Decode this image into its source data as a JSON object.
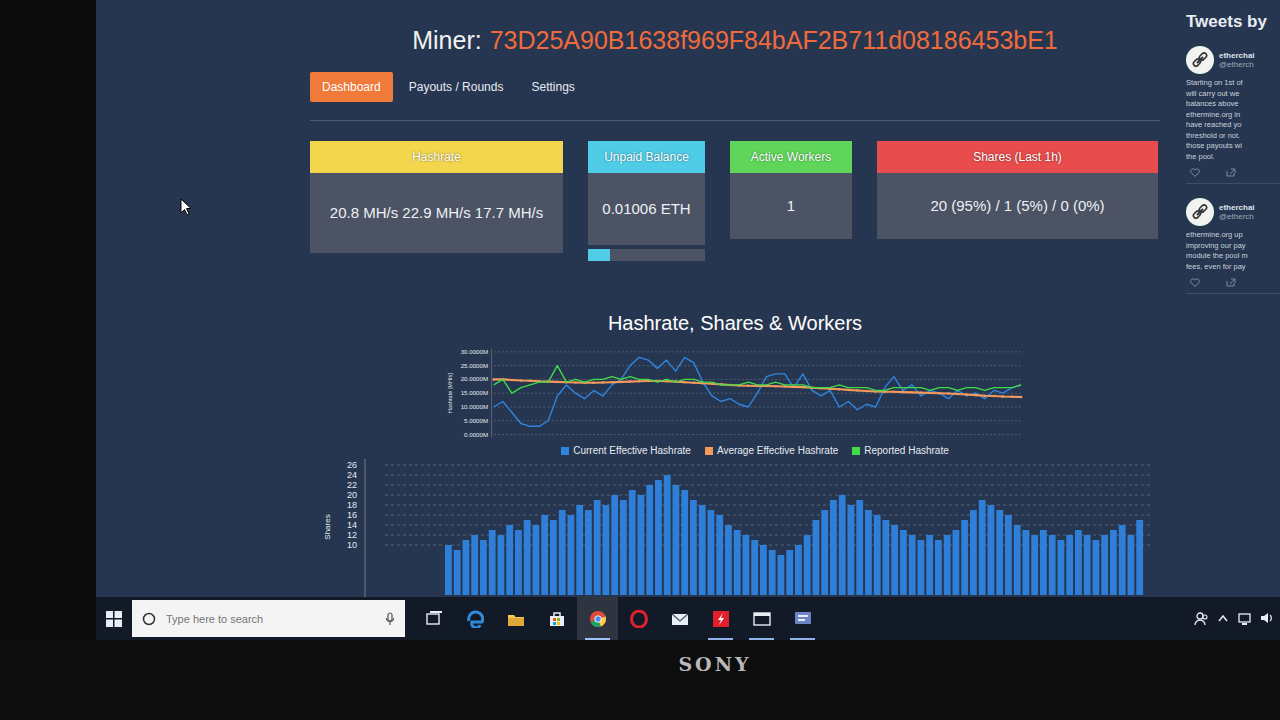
{
  "miner": {
    "label": "Miner:",
    "address": "73D25A90B1638f969F84bAF2B711d08186453bE1"
  },
  "tabs": [
    {
      "label": "Dashboard",
      "selected": true
    },
    {
      "label": "Payouts / Rounds",
      "selected": false
    },
    {
      "label": "Settings",
      "selected": false
    }
  ],
  "cards": [
    {
      "kind": "text",
      "title": "Hashrate",
      "color": "#f3d64c",
      "value": "20.8 MH/s  22.9 MH/s  17.7 MH/s"
    },
    {
      "kind": "progress",
      "title": "Unpaid Balance",
      "color": "#4fcde6",
      "value": "0.01006 ETH",
      "level": 0.19
    },
    {
      "kind": "text",
      "title": "Active Workers",
      "color": "#5fd65a",
      "value": "1"
    },
    {
      "kind": "text",
      "title": "Shares (Last 1h)",
      "color": "#e84c4c",
      "value": "20 (95%) / 1 (5%) / 0 (0%)"
    }
  ],
  "chart": {
    "title": "Hashrate, Shares & Workers",
    "y_label": "Hashrate [MH/s]",
    "ticks": [
      "30.0000M",
      "25.0000M",
      "20.0000M",
      "15.0000M",
      "10.0000M",
      "5.0000M",
      "0.0000M"
    ],
    "series": [
      {
        "name": "Current Effective Hashrate",
        "color": "#2f86e0",
        "values": [
          10,
          12,
          8,
          4,
          3,
          3,
          5,
          14,
          18,
          15,
          13,
          16,
          14,
          18,
          20,
          25,
          28,
          27,
          24,
          27,
          23,
          28,
          26,
          19,
          14,
          12,
          13,
          11,
          10,
          15,
          21,
          22,
          22,
          17,
          22,
          16,
          14,
          16,
          10,
          12,
          9,
          11,
          10,
          17,
          21,
          16,
          18,
          14,
          16,
          15,
          13,
          16,
          14,
          15,
          13,
          16,
          15,
          17,
          18
        ]
      },
      {
        "name": "Average Effective Hashrate",
        "color": "#f39a5c",
        "values": [
          20,
          20,
          19.8,
          19.6,
          19.5,
          19.3,
          19.2,
          19.1,
          19,
          18.9,
          18.8,
          18.8,
          18.9,
          19,
          19.1,
          19.2,
          19.3,
          19.4,
          19.4,
          19.3,
          19.2,
          19,
          18.8,
          18.6,
          18.4,
          18.2,
          18,
          17.8,
          17.7,
          17.6,
          17.6,
          17.5,
          17.4,
          17.3,
          17.2,
          17,
          16.8,
          16.6,
          16.4,
          16.2,
          16,
          15.8,
          15.6,
          15.5,
          15.5,
          15.4,
          15.3,
          15.2,
          15.1,
          15,
          14.9,
          14.7,
          14.5,
          14.3,
          14.1,
          14,
          13.8,
          13.7,
          13.6
        ]
      },
      {
        "name": "Reported Hashrate",
        "color": "#3fdc48",
        "values": [
          18,
          20,
          15,
          17,
          18,
          19,
          19,
          25,
          19,
          20,
          19,
          20,
          20,
          21,
          20,
          21,
          20,
          20,
          19,
          20,
          19,
          20,
          20,
          19,
          19,
          18,
          18,
          18,
          19,
          18,
          18,
          19,
          18,
          18,
          18,
          17,
          17,
          17,
          18,
          17,
          17,
          17,
          16,
          16,
          17,
          17,
          17,
          17,
          16,
          17,
          17,
          16,
          17,
          17,
          16,
          17,
          17,
          17,
          18
        ]
      }
    ]
  },
  "shares_chart": {
    "y_label": "Shares",
    "ticks": [
      "26",
      "24",
      "22",
      "20",
      "18",
      "16",
      "14",
      "12",
      "10"
    ],
    "values": [
      10,
      9,
      11,
      12,
      11,
      13,
      12,
      14,
      13,
      15,
      14,
      16,
      15,
      17,
      16,
      18,
      17,
      19,
      18,
      20,
      19,
      21,
      20,
      22,
      23,
      24,
      22,
      21,
      19,
      18,
      17,
      16,
      14,
      13,
      12,
      11,
      10,
      9,
      8,
      9,
      10,
      12,
      15,
      17,
      19,
      20,
      18,
      19,
      17,
      16,
      15,
      14,
      13,
      12,
      11,
      12,
      11,
      12,
      13,
      15,
      17,
      19,
      18,
      17,
      16,
      14,
      13,
      12,
      13,
      12,
      11,
      12,
      13,
      12,
      11,
      12,
      13,
      14,
      12,
      15
    ]
  },
  "tweets": {
    "header": "Tweets by",
    "items": [
      {
        "name": "etherchai",
        "handle": "@etherch",
        "lines": [
          "Starting on 1st of",
          "will carry out we",
          "balances above",
          "ethermine.org in",
          "have reached yo",
          "threshold or not.",
          "those payouts wi",
          "the pool."
        ]
      },
      {
        "name": "etherchai",
        "handle": "@etherch",
        "lines": [
          "ethermine.org up",
          "improving our pay",
          "module the pool m",
          "fees, even for pay"
        ]
      }
    ]
  },
  "taskbar": {
    "search_placeholder": "Type here to search",
    "apps": [
      {
        "kind": "taskview",
        "selected": false,
        "open": false
      },
      {
        "kind": "edge",
        "selected": false,
        "open": false
      },
      {
        "kind": "explorer",
        "selected": false,
        "open": false
      },
      {
        "kind": "store",
        "selected": false,
        "open": false
      },
      {
        "kind": "chrome",
        "selected": true,
        "open": true
      },
      {
        "kind": "opera",
        "selected": false,
        "open": false
      },
      {
        "kind": "mail",
        "selected": false,
        "open": false
      },
      {
        "kind": "flash",
        "selected": false,
        "open": true
      },
      {
        "kind": "window",
        "selected": false,
        "open": true
      },
      {
        "kind": "chat",
        "selected": false,
        "open": true
      }
    ],
    "tray": [
      {
        "kind": "people"
      },
      {
        "kind": "chevron"
      },
      {
        "kind": "network"
      },
      {
        "kind": "volume"
      }
    ]
  },
  "monitor": {
    "brand": "SONY"
  }
}
